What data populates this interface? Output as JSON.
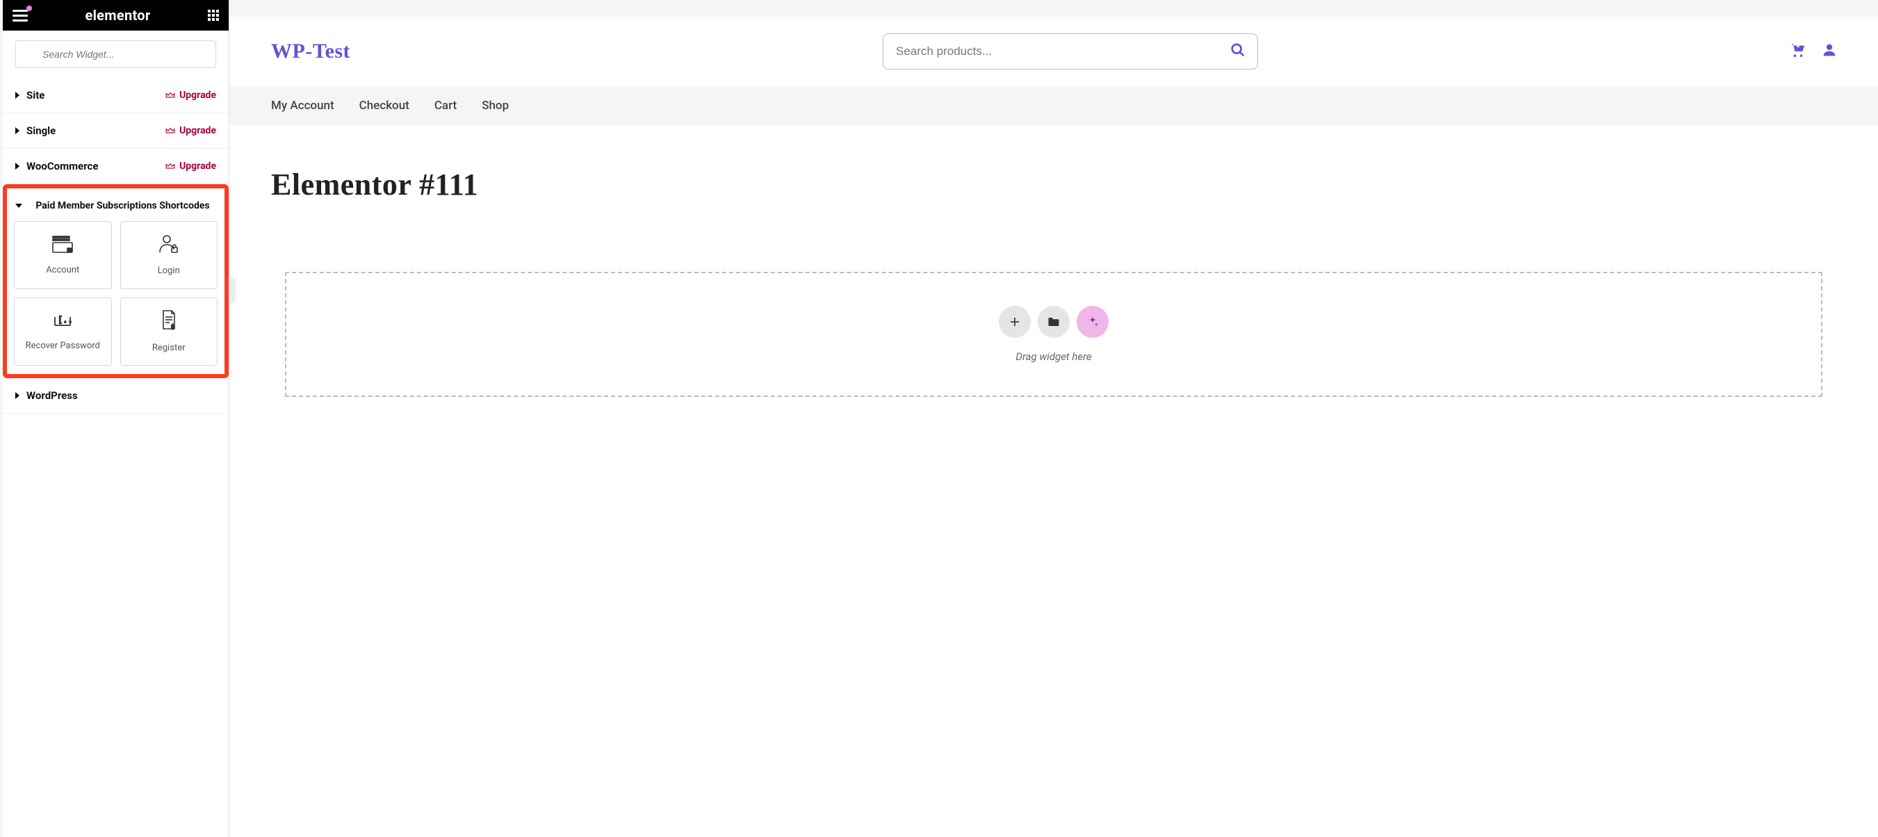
{
  "sidebar": {
    "logo": "elementor",
    "search_placeholder": "Search Widget...",
    "categories": [
      {
        "name": "Site",
        "upgrade": "Upgrade"
      },
      {
        "name": "Single",
        "upgrade": "Upgrade"
      },
      {
        "name": "WooCommerce",
        "upgrade": "Upgrade"
      }
    ],
    "pms": {
      "title": "Paid Member Subscriptions Shortcodes",
      "widgets": [
        {
          "label": "Account"
        },
        {
          "label": "Login"
        },
        {
          "label": "Recover Password"
        },
        {
          "label": "Register"
        }
      ]
    },
    "wordpress": {
      "name": "WordPress"
    }
  },
  "header": {
    "brand": "WP-Test",
    "product_search_placeholder": "Search products..."
  },
  "nav": {
    "items": [
      {
        "label": "My Account"
      },
      {
        "label": "Checkout"
      },
      {
        "label": "Cart"
      },
      {
        "label": "Shop"
      }
    ]
  },
  "page": {
    "title": "Elementor #111",
    "drop_hint": "Drag widget here"
  }
}
